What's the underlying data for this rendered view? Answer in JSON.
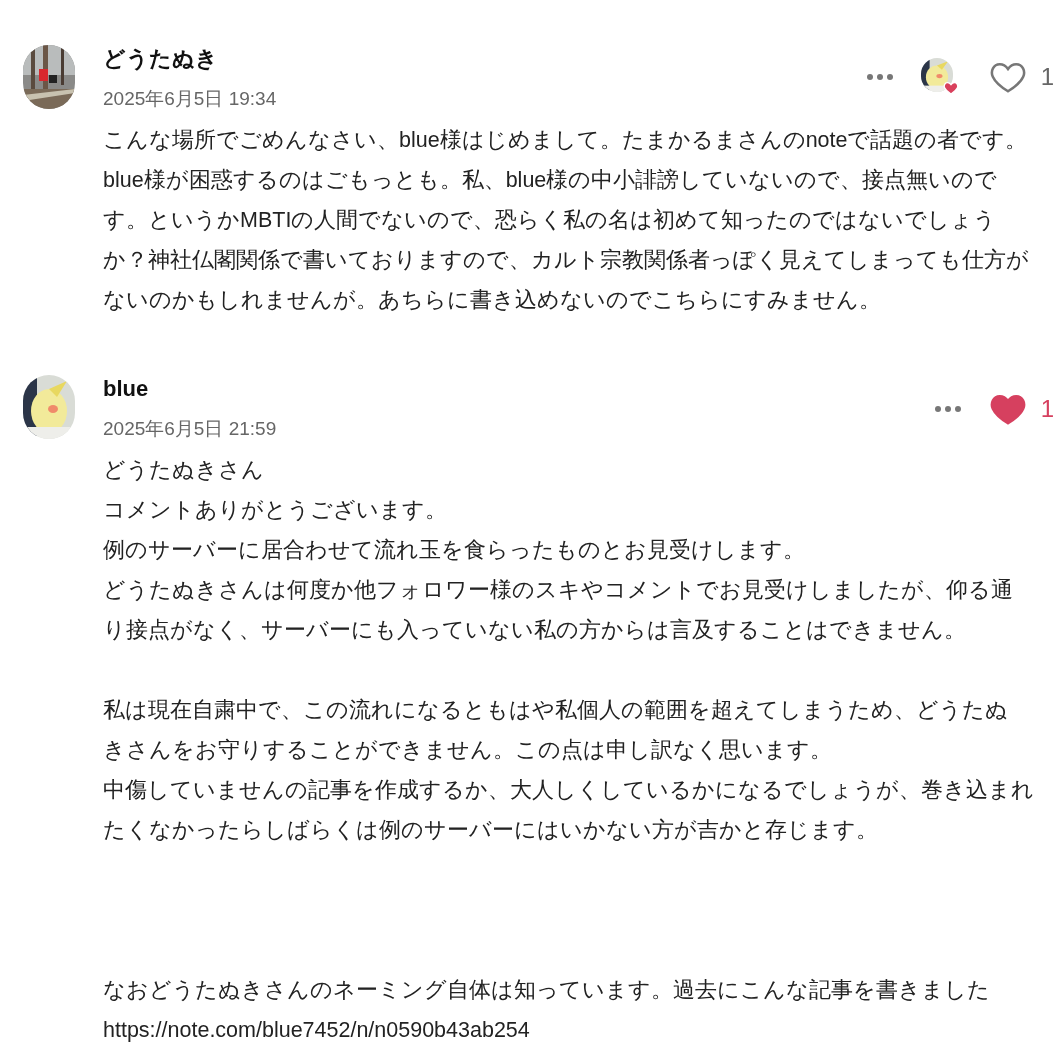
{
  "comments": [
    {
      "author": "どうたぬき",
      "date": "2025年6月5日 19:34",
      "avatar": {
        "kind": "picture"
      },
      "liked": false,
      "liked_by_creator": true,
      "like_count": "1",
      "blocks": [
        {
          "kind": "paragraph",
          "lines": [
            "こんな場所でごめんなさい、blue様はじめまして。たまかるまさんのnoteで話題の者です。",
            "blue様が困惑するのはごもっとも。私、blue様の中小誹謗していないので、接点無いので",
            "す。というかMBTIの人間でないので、恐らく私の名は初めて知ったのではないでしょう",
            "か？神社仏閣関係で書いておりますので、カルト宗教関係者っぽく見えてしまっても仕方が",
            "ないのかもしれませんが。あちらに書き込めないのでこちらにすみません。"
          ]
        }
      ]
    },
    {
      "author": "blue",
      "date": "2025年6月5日 21:59",
      "avatar": {
        "kind": "picture"
      },
      "liked": true,
      "liked_by_creator": false,
      "like_count": "1",
      "blocks": [
        {
          "kind": "paragraph",
          "lines": [
            "どうたぬきさん",
            "コメントありがとうございます。",
            "例のサーバーに居合わせて流れ玉を食らったものとお見受けします。",
            "どうたぬきさんは何度か他フォロワー様のスキやコメントでお見受けしましたが、仰る通",
            "り接点がなく、サーバーにも入っていない私の方からは言及することはできません。"
          ]
        },
        {
          "kind": "paragraph",
          "lines": [
            "私は現在自粛中で、この流れになるともはや私個人の範囲を超えてしまうため、どうたぬ",
            "きさんをお守りすることができません。この点は申し訳なく思います。",
            "中傷していませんの記事を作成するか、大人しくしているかになるでしょうが、巻き込まれ",
            "たくなかったらしばらくは例のサーバーにはいかない方が吉かと存じます。"
          ]
        },
        {
          "kind": "postscript",
          "lines": [
            "なおどうたぬきさんのネーミング自体は知っています。過去にこんな記事を書きました",
            "https://note.com/blue7452/n/n0590b43ab254"
          ]
        }
      ]
    }
  ]
}
